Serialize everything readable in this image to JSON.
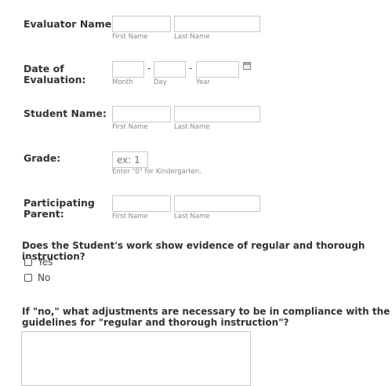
{
  "evaluator": {
    "label": "Evaluator Name:",
    "first_sub": "First Name",
    "last_sub": "Last Name"
  },
  "date": {
    "label_line1": "Date of",
    "label_line2": "Evaluation:",
    "dash1": "-",
    "dash2": "-",
    "month_sub": "Month",
    "day_sub": "Day",
    "year_sub": "Year",
    "calendar_icon": "calendar-icon"
  },
  "student": {
    "label": "Student Name:",
    "first_sub": "First Name",
    "last_sub": "Last Name"
  },
  "grade": {
    "label": "Grade:",
    "placeholder": "ex: 1",
    "hint": "Enter \"0\" for Kindergarten."
  },
  "parent": {
    "label_line1": "Participating",
    "label_line2": "Parent:",
    "first_sub": "First Name",
    "last_sub": "Last Name"
  },
  "instruction_question": {
    "text": "Does the Student's work show evidence of regular and thorough instruction?",
    "options": [
      "Yes",
      "No"
    ]
  },
  "adjustments_question": {
    "line1": "If \"no,\" what adjustments are necessary to be in compliance with the",
    "line2": "guidelines for \"regular and thorough instruction\"?"
  }
}
